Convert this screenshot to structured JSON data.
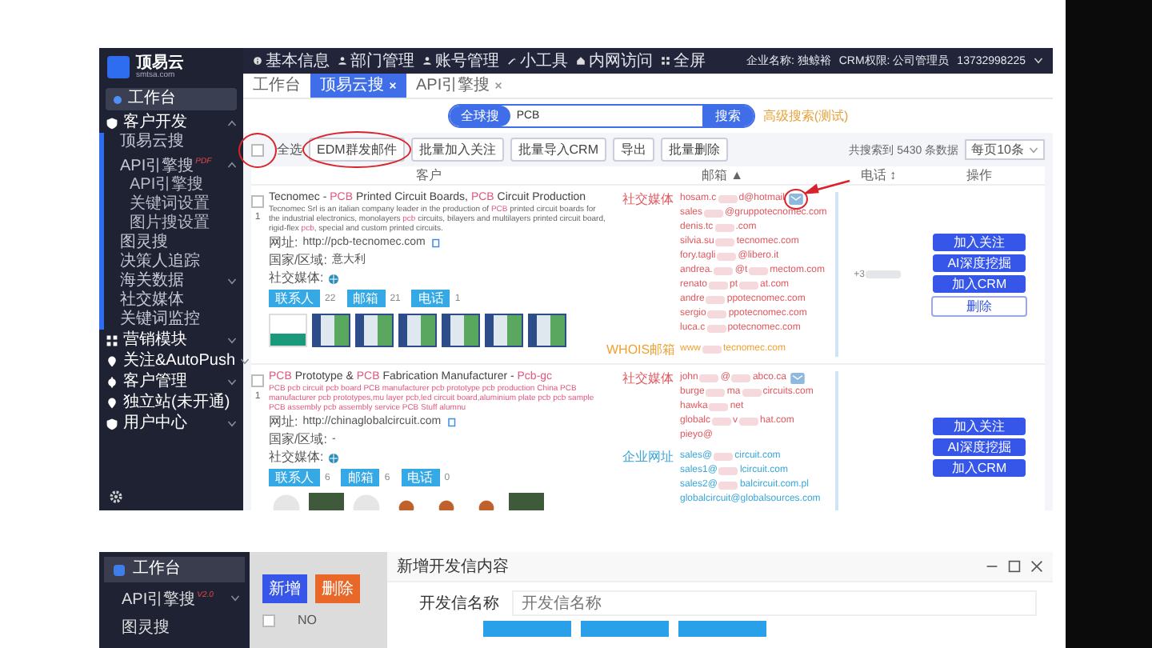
{
  "top_screen": {
    "logo": {
      "name": "顶易云",
      "domain": "smtsa.com"
    },
    "sidebar": [
      {
        "kind": "home",
        "label": "工作台",
        "selected": true
      },
      {
        "kind": "folder",
        "label": "客户开发",
        "expanded": true,
        "children": [
          {
            "kind": "leaf",
            "label": "顶易云搜"
          },
          {
            "kind": "folder",
            "label": "API引擎搜",
            "badge": "PDF",
            "expanded": true,
            "children": [
              {
                "kind": "leaf",
                "label": "API引擎搜"
              },
              {
                "kind": "leaf",
                "label": "关键词设置"
              },
              {
                "kind": "leaf",
                "label": "图片搜设置"
              }
            ]
          },
          {
            "kind": "leaf",
            "label": "图灵搜"
          },
          {
            "kind": "leaf",
            "label": "决策人追踪"
          },
          {
            "kind": "folder",
            "label": "海关数据",
            "expanded": false
          },
          {
            "kind": "leaf",
            "label": "社交媒体"
          },
          {
            "kind": "leaf",
            "label": "关键词监控"
          }
        ]
      },
      {
        "kind": "folder",
        "label": "营销模块",
        "expanded": false
      },
      {
        "kind": "folder",
        "label": "关注&AutoPush",
        "expanded": false
      },
      {
        "kind": "folder",
        "label": "客户管理",
        "expanded": false
      },
      {
        "kind": "leaf_top",
        "label": "独立站(未开通)"
      },
      {
        "kind": "folder",
        "label": "用户中心",
        "expanded": false
      }
    ],
    "topbar": {
      "items": [
        "基本信息",
        "部门管理",
        "账号管理",
        "小工具",
        "内网访问",
        "全屏"
      ],
      "company": "企业名称: 独鲸裕",
      "crm": "CRM权限: 公司管理员",
      "user": "13732998225"
    },
    "tabs": [
      {
        "label": "工作台",
        "selected": false,
        "closable": false
      },
      {
        "label": "顶易云搜",
        "selected": true,
        "closable": true
      },
      {
        "label": "API引擎搜",
        "selected": false,
        "closable": true
      }
    ],
    "search": {
      "mode": "全球搜",
      "value": "PCB",
      "button": "搜索",
      "advanced": "高级搜索(测试)"
    },
    "toolbar": {
      "select_all": "全选",
      "select_all_checked": false,
      "select_all_circled": true,
      "buttons": [
        {
          "label": "EDM群发邮件",
          "circled": true
        },
        {
          "label": "批量加入关注",
          "circled": false
        },
        {
          "label": "批量导入CRM",
          "circled": false
        },
        {
          "label": "导出",
          "circled": false
        },
        {
          "label": "批量删除",
          "circled": false
        }
      ],
      "total": "共搜索到 5430 条数据",
      "page_size": "每页10条"
    },
    "columns": [
      "客户",
      "邮箱 ▲",
      "电话 ↕",
      "操作"
    ],
    "rows": [
      {
        "index": "1",
        "checked": false,
        "title": "Tecnomec - **PCB** Printed Circuit Boards, **PCB** Circuit Production",
        "description": "Tecnomec Srl is an italian company leader in the production of **PCB** printed circuit boards for the industrial electronics, monolayers **pcb** circuits, bilayers and multilayers printed circuit board, rigid-flex **pcb**, special and custom printed circuits.",
        "description_highlighted": false,
        "website_label": "网址:",
        "website": "http://pcb-tecnomec.com",
        "country_label": "国家/区域:",
        "country": "意大利",
        "social_label": "社交媒体:",
        "counts": [
          {
            "label": "联系人",
            "value": "22"
          },
          {
            "label": "邮箱",
            "value": "21"
          },
          {
            "label": "电话",
            "value": "1"
          }
        ],
        "thumbnails": [
          {
            "kind": "logo"
          },
          {
            "kind": "page"
          },
          {
            "kind": "page"
          },
          {
            "kind": "page"
          },
          {
            "kind": "page"
          },
          {
            "kind": "page"
          },
          {
            "kind": "page"
          }
        ],
        "email_groups": [
          {
            "label": "社交媒体",
            "color": "#e0585f",
            "emails": [
              {
                "parts": [
                  "hosam.c",
                  "d@hotmail"
                ]
              },
              {
                "parts": [
                  "sales",
                  "@gruppotecnomec.com"
                ]
              },
              {
                "parts": [
                  "denis.tc",
                  ".com"
                ]
              },
              {
                "parts": [
                  "silvia.su",
                  "tecnomec.com"
                ]
              },
              {
                "parts": [
                  "fory.tagli",
                  "@libero.it"
                ]
              },
              {
                "parts": [
                  "andrea.",
                  "@t",
                  "mectom.com"
                ]
              },
              {
                "parts": [
                  "renato",
                  "pt",
                  "at.com"
                ]
              },
              {
                "parts": [
                  "andre",
                  "ppotecnomec.com"
                ]
              },
              {
                "parts": [
                  "sergio",
                  "ppotecnomec.com"
                ]
              },
              {
                "parts": [
                  "luca.c",
                  "potecnomec.com"
                ]
              }
            ]
          },
          {
            "label": "WHOIS邮箱",
            "color": "#f0a030",
            "emails": [
              {
                "parts": [
                  "www",
                  "tecnomec.com"
                ]
              }
            ]
          }
        ],
        "mail_icon_circled": true,
        "phone": [
          "+3"
        ],
        "actions": [
          {
            "label": "加入关注",
            "kind": "primary"
          },
          {
            "label": "AI深度挖掘",
            "kind": "primary"
          },
          {
            "label": "加入CRM",
            "kind": "primary"
          },
          {
            "label": "删除",
            "kind": "outline"
          }
        ]
      },
      {
        "index": "1",
        "checked": false,
        "title": "**PCB** Prototype & **PCB** Fabrication Manufacturer - **Pcb-gc**",
        "description": "PCB pcb circuit pcb board PCB manufacturer pcb prototype pcb production China PCB manufacturer pcb prototypes,mu layer pcb,led circuit board,aluminium plate pcb pcb sample PCB assembly pcb assembly service PCB Stuff alumnu",
        "description_highlighted": true,
        "website_label": "网址:",
        "website": "http://chinaglobalcircuit.com",
        "country_label": "国家/区域:",
        "country": "-",
        "social_label": "社交媒体:",
        "counts": [
          {
            "label": "联系人",
            "value": "6"
          },
          {
            "label": "邮箱",
            "value": "6"
          },
          {
            "label": "电话",
            "value": "0"
          }
        ],
        "thumbnails": [
          {
            "kind": "disc"
          },
          {
            "kind": "board"
          },
          {
            "kind": "disc"
          },
          {
            "kind": "part"
          },
          {
            "kind": "part"
          },
          {
            "kind": "part"
          },
          {
            "kind": "board"
          }
        ],
        "email_groups": [
          {
            "label": "社交媒体",
            "color": "#e0585f",
            "emails": [
              {
                "parts": [
                  "john",
                  "@",
                  "abco.ca"
                ]
              },
              {
                "parts": [
                  "burge",
                  "ma",
                  "circuits.com"
                ]
              },
              {
                "parts": [
                  "hawka",
                  "net"
                ]
              },
              {
                "parts": [
                  "globalc",
                  "v",
                  "hat.com"
                ]
              },
              {
                "parts": [
                  "pieyo@"
                ]
              }
            ]
          },
          {
            "label": "企业网址",
            "color": "#3aa6d8",
            "emails": [
              {
                "parts": [
                  "sales@",
                  "circuit.com"
                ]
              },
              {
                "parts": [
                  "sales1@",
                  "lcircuit.com"
                ]
              },
              {
                "parts": [
                  "sales2@",
                  "balcircuit.com.pl"
                ]
              },
              {
                "parts": [
                  "globalcircuit@globalsources.com"
                ]
              }
            ]
          }
        ],
        "mail_icon_circled": false,
        "actions": [
          {
            "label": "加入关注",
            "kind": "primary"
          },
          {
            "label": "AI深度挖掘",
            "kind": "primary"
          },
          {
            "label": "加入CRM",
            "kind": "primary"
          }
        ]
      }
    ]
  },
  "bottom_screen": {
    "sidebar": [
      {
        "kind": "home",
        "label": "工作台",
        "selected": true
      },
      {
        "kind": "folder",
        "label": "API引擎搜",
        "badge": "V2.0",
        "expanded": false
      },
      {
        "kind": "leaf",
        "label": "图灵搜"
      }
    ],
    "buttons": [
      {
        "label": "新增",
        "kind": "primary"
      },
      {
        "label": "删除",
        "kind": "danger"
      }
    ],
    "table_header": "NO",
    "header_checked": false,
    "dialog": {
      "title": "新增开发信内容",
      "field_label": "开发信名称",
      "placeholder": "开发信名称",
      "buttons": [
        {
          "kind": "primary"
        },
        {
          "kind": "primary"
        },
        {
          "kind": "primary"
        }
      ]
    }
  }
}
